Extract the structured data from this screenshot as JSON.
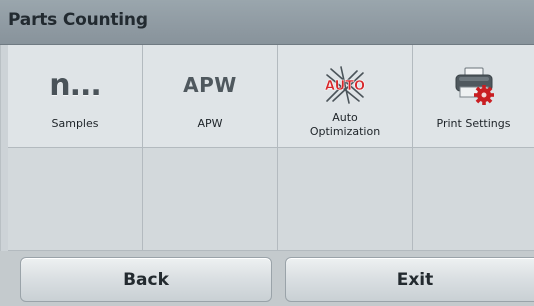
{
  "header": {
    "title": "Parts Counting"
  },
  "menu": {
    "items": [
      {
        "label": "Samples",
        "icon": "n-ellipsis-icon",
        "glyph": "n..."
      },
      {
        "label": "APW",
        "icon": "apw-text-icon",
        "glyph": "APW"
      },
      {
        "label_lines": [
          "Auto",
          "Optimization"
        ],
        "icon": "auto-optimization-icon",
        "badge": "AUTO"
      },
      {
        "label": "Print Settings",
        "icon": "printer-gear-icon"
      }
    ]
  },
  "footer": {
    "back_label": "Back",
    "exit_label": "Exit"
  },
  "colors": {
    "header_bg": "#8f9aa2",
    "cell_bg": "#dfe4e7",
    "empty_cell_bg": "#d3d9dc",
    "auto_red": "#d6262a",
    "gear_red": "#c91e22"
  }
}
